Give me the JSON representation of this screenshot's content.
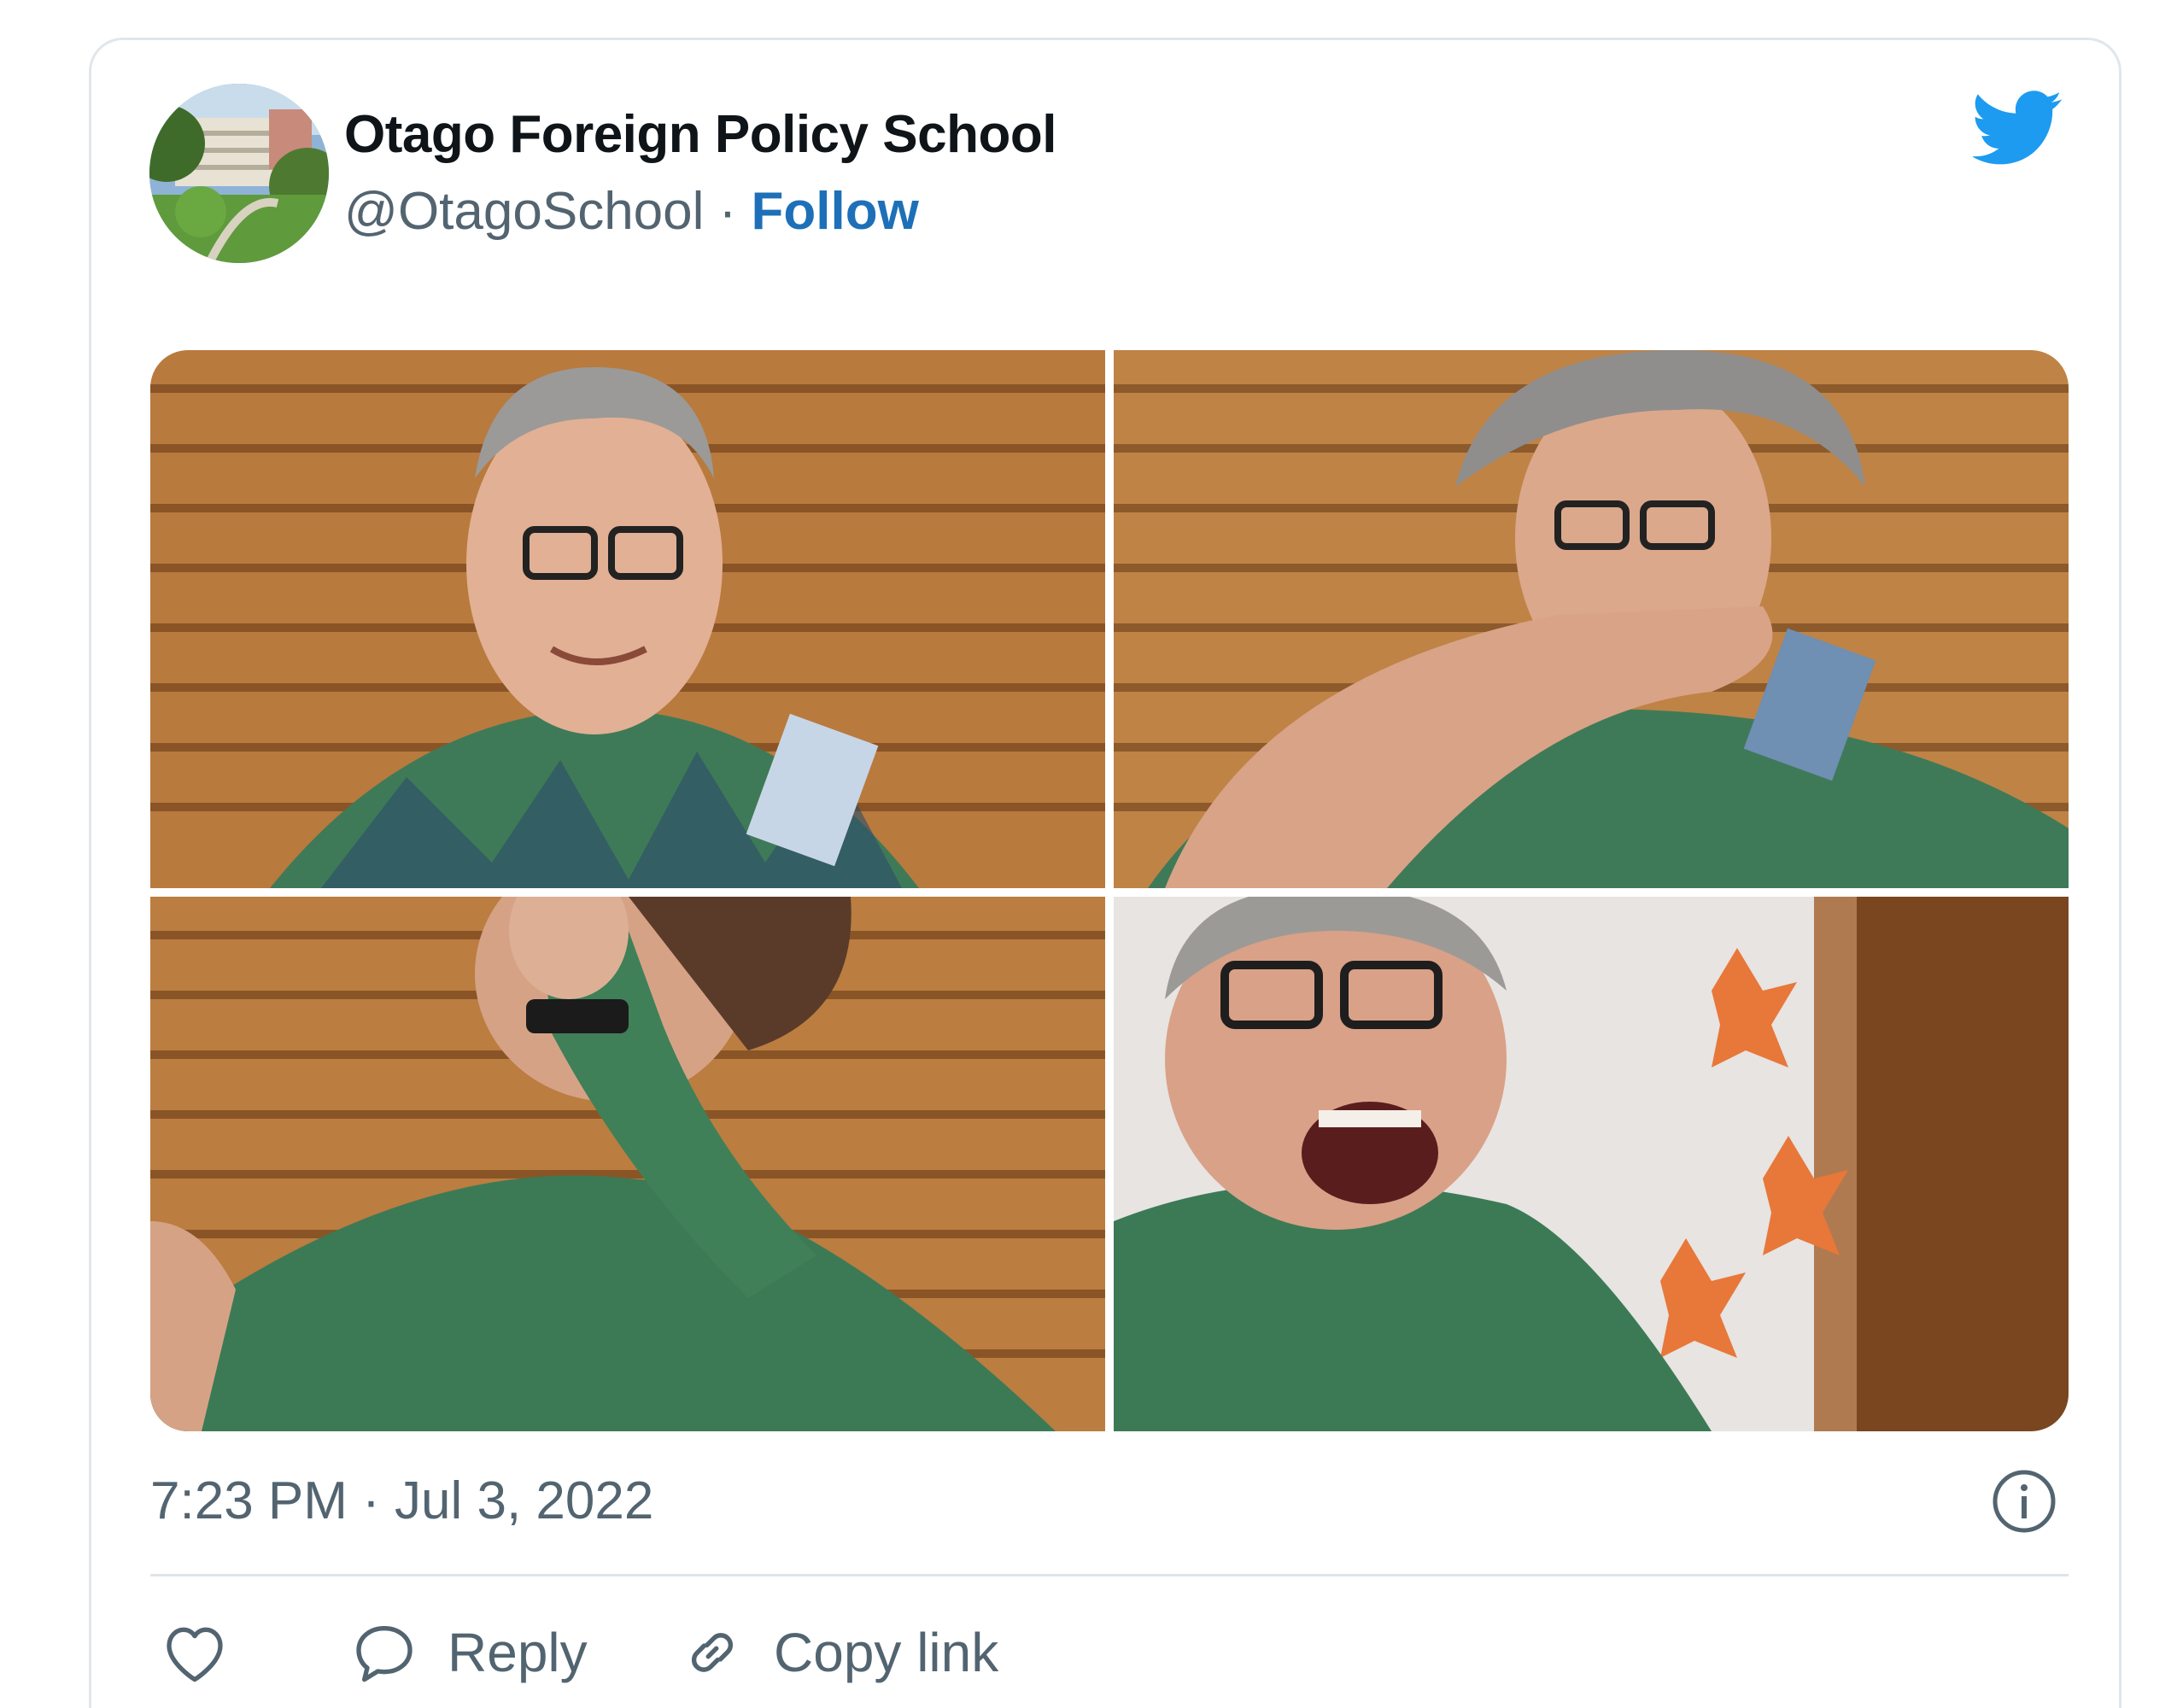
{
  "tweet": {
    "author_name": "Otago Foreign Policy School",
    "handle": "@OtagoSchool",
    "separator": " · ",
    "follow_label": "Follow",
    "timestamp": "7:23 PM · Jul 3, 2022"
  },
  "actions": {
    "reply_label": "Reply",
    "copy_link_label": "Copy link"
  },
  "icons": {
    "brand": "twitter-bird-icon",
    "info": "info-icon",
    "like": "heart-icon",
    "reply": "speech-bubble-icon",
    "copy_link": "link-icon"
  },
  "colors": {
    "brand_blue": "#1d9bf0",
    "follow_blue": "#1d70b8",
    "text_primary": "#0f1419",
    "text_secondary": "#536471"
  }
}
